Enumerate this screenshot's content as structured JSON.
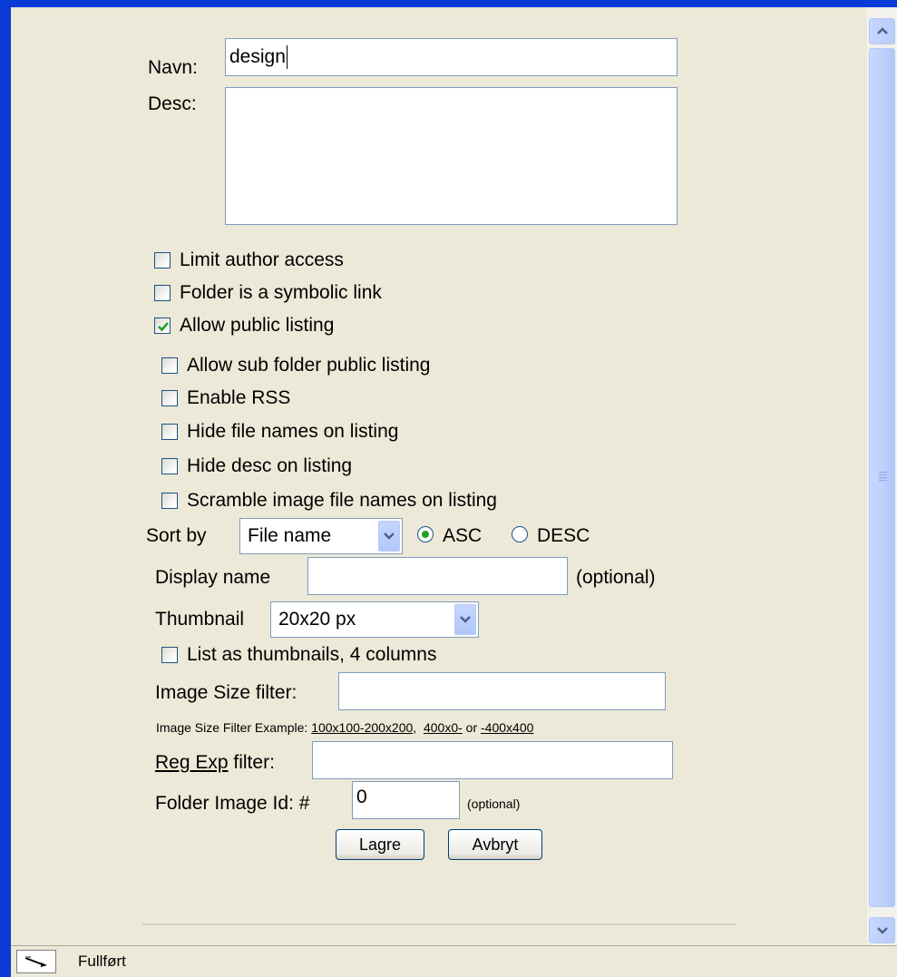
{
  "form": {
    "name_label": "Navn:",
    "name_value": "design",
    "desc_label": "Desc:",
    "desc_value": "",
    "checkboxes": {
      "limit_author": {
        "label": "Limit author access",
        "checked": false
      },
      "symbolic_link": {
        "label": "Folder is a symbolic link",
        "checked": false
      },
      "public_listing": {
        "label": "Allow public listing",
        "checked": true
      },
      "sub_folder_public": {
        "label": "Allow sub folder public listing",
        "checked": false
      },
      "enable_rss": {
        "label": "Enable RSS",
        "checked": false
      },
      "hide_file_names": {
        "label": "Hide file names on listing",
        "checked": false
      },
      "hide_desc": {
        "label": "Hide desc on listing",
        "checked": false
      },
      "scramble_names": {
        "label": "Scramble image file names on listing",
        "checked": false
      },
      "list_thumbnails": {
        "label": "List as thumbnails, 4 columns",
        "checked": false
      }
    },
    "sort_by_label": "Sort by",
    "sort_by_value": "File name",
    "asc_label": "ASC",
    "desc_order_label": "DESC",
    "sort_order_selected": "ASC",
    "display_name_label": "Display name",
    "display_name_value": "",
    "display_name_hint": "(optional)",
    "thumbnail_label": "Thumbnail",
    "thumbnail_value": "20x20 px",
    "image_size_filter_label": "Image Size filter:",
    "image_size_filter_value": "",
    "example_prefix": "Image Size Filter Example:",
    "example_1": "100x100-200x200",
    "example_sep": ",",
    "example_2": "400x0-",
    "example_or": "or",
    "example_3": "-400x400",
    "regexp_link": "Reg Exp",
    "regexp_label_suffix": "filter:",
    "regexp_value": "",
    "folder_image_label": "Folder Image Id: #",
    "folder_image_value": "0",
    "folder_image_hint": "(optional)",
    "save_label": "Lagre",
    "cancel_label": "Avbryt"
  },
  "statusbar": {
    "text": "Fullført",
    "icon": "page-loading-icon"
  },
  "colors": {
    "window_border": "#0a3ad6",
    "page_bg": "#ece9d8",
    "field_border": "#7f9db9",
    "check_green": "#21a121"
  }
}
